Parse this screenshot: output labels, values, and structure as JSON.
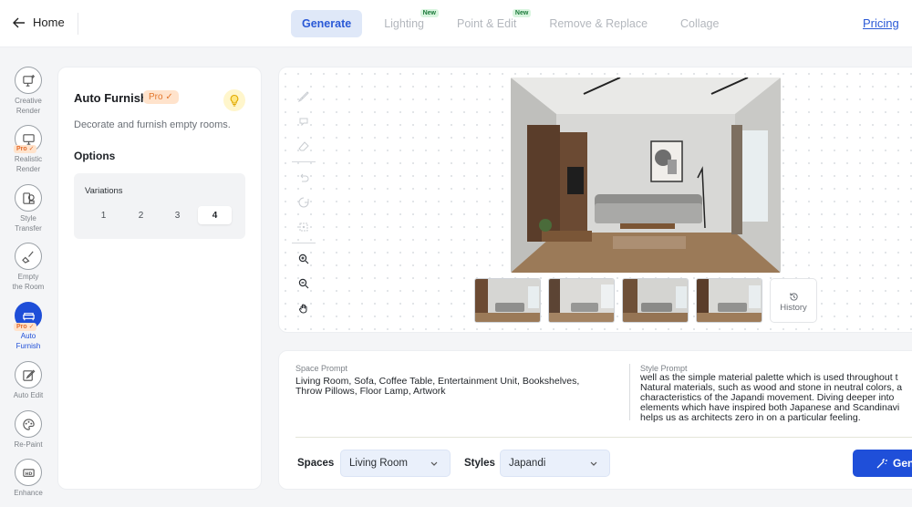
{
  "topbar": {
    "home_label": "Home",
    "tabs": [
      {
        "label": "Generate",
        "active": true,
        "new": ""
      },
      {
        "label": "Lighting",
        "active": false,
        "new": "New"
      },
      {
        "label": "Point & Edit",
        "active": false,
        "new": "New"
      },
      {
        "label": "Remove & Replace",
        "active": false,
        "new": ""
      },
      {
        "label": "Collage",
        "active": false,
        "new": ""
      }
    ],
    "pricing_label": "Pricing"
  },
  "leftnav": {
    "items": [
      {
        "label1": "Creative",
        "label2": "Render",
        "icon": "monitor-plus-icon",
        "pro": ""
      },
      {
        "label1": "Realistic",
        "label2": "Render",
        "icon": "monitor-icon",
        "pro": "Pro ✓"
      },
      {
        "label1": "Style",
        "label2": "Transfer",
        "icon": "style-transfer-icon",
        "pro": ""
      },
      {
        "label1": "Empty",
        "label2": "the Room",
        "icon": "broom-icon",
        "pro": ""
      },
      {
        "label1": "Auto",
        "label2": "Furnish",
        "icon": "sofa-icon",
        "pro": "Pro ✓"
      },
      {
        "label1": "Auto Edit",
        "label2": "",
        "icon": "edit-icon",
        "pro": ""
      },
      {
        "label1": "Re-Paint",
        "label2": "",
        "icon": "palette-icon",
        "pro": ""
      },
      {
        "label1": "Enhance",
        "label2": "",
        "icon": "hd-icon",
        "pro": ""
      }
    ]
  },
  "panel": {
    "title": "Auto Furnish",
    "pro_badge": "Pro ✓",
    "description": "Decorate and furnish empty rooms.",
    "options_heading": "Options",
    "variations_label": "Variations",
    "variations": [
      "1",
      "2",
      "3",
      "4"
    ],
    "selected_variation": "4"
  },
  "canvas": {
    "history_label": "History"
  },
  "bottom": {
    "space_prompt_label": "Space Prompt",
    "space_prompt_line1": "Living Room, Sofa, Coffee Table, Entertainment Unit, Bookshelves,",
    "space_prompt_line2": "Throw Pillows, Floor Lamp, Artwork",
    "style_prompt_label": "Style Prompt",
    "style_prompt_lines": [
      "well as the simple material palette which is used throughout t",
      "Natural materials, such as wood and stone in neutral colors, a",
      "characteristics of the Japandi movement. Diving deeper into",
      "elements which have inspired both Japanese and Scandinavi",
      "helps us as architects zero in on a particular feeling."
    ],
    "spaces_label": "Spaces",
    "spaces_value": "Living Room",
    "styles_label": "Styles",
    "styles_value": "Japandi",
    "generate_label": "Gen"
  },
  "colors": {
    "accent": "#1f4fd9",
    "tab_active_bg": "#dfe8f8",
    "pro_orange": "#e3762c"
  }
}
